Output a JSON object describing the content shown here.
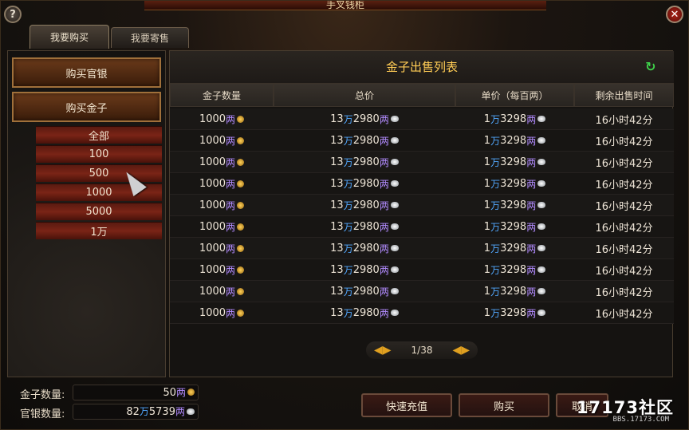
{
  "window": {
    "title": "手叉钱柜"
  },
  "tabs": [
    {
      "label": "我要购买"
    },
    {
      "label": "我要寄售"
    }
  ],
  "left_nav": {
    "buy_silver": "购买官银",
    "buy_gold": "购买金子",
    "filters": [
      "全部",
      "100",
      "500",
      "1000",
      "5000",
      "1万"
    ]
  },
  "list": {
    "title": "金子出售列表",
    "columns": [
      "金子数量",
      "总价",
      "单价（每百两）",
      "剩余出售时间"
    ],
    "units": {
      "liang": "两",
      "wan": "万"
    },
    "rows": [
      {
        "qty": "1000",
        "total_wan": "13",
        "total_rest": "2980",
        "unit_wan": "1",
        "unit_rest": "3298",
        "time": "16小时42分"
      },
      {
        "qty": "1000",
        "total_wan": "13",
        "total_rest": "2980",
        "unit_wan": "1",
        "unit_rest": "3298",
        "time": "16小时42分"
      },
      {
        "qty": "1000",
        "total_wan": "13",
        "total_rest": "2980",
        "unit_wan": "1",
        "unit_rest": "3298",
        "time": "16小时42分"
      },
      {
        "qty": "1000",
        "total_wan": "13",
        "total_rest": "2980",
        "unit_wan": "1",
        "unit_rest": "3298",
        "time": "16小时42分"
      },
      {
        "qty": "1000",
        "total_wan": "13",
        "total_rest": "2980",
        "unit_wan": "1",
        "unit_rest": "3298",
        "time": "16小时42分"
      },
      {
        "qty": "1000",
        "total_wan": "13",
        "total_rest": "2980",
        "unit_wan": "1",
        "unit_rest": "3298",
        "time": "16小时42分"
      },
      {
        "qty": "1000",
        "total_wan": "13",
        "total_rest": "2980",
        "unit_wan": "1",
        "unit_rest": "3298",
        "time": "16小时42分"
      },
      {
        "qty": "1000",
        "total_wan": "13",
        "total_rest": "2980",
        "unit_wan": "1",
        "unit_rest": "3298",
        "time": "16小时42分"
      },
      {
        "qty": "1000",
        "total_wan": "13",
        "total_rest": "2980",
        "unit_wan": "1",
        "unit_rest": "3298",
        "time": "16小时42分"
      },
      {
        "qty": "1000",
        "total_wan": "13",
        "total_rest": "2980",
        "unit_wan": "1",
        "unit_rest": "3298",
        "time": "16小时42分"
      }
    ],
    "pagination": "1/38"
  },
  "footer": {
    "gold_label": "金子数量:",
    "gold_value": "50",
    "silver_label": "官银数量:",
    "silver_wan": "82",
    "silver_rest": "5739",
    "recharge_btn": "快速充值",
    "buy_btn": "购买",
    "third_btn": "取消"
  },
  "watermark": {
    "brand": "17173社区",
    "url": "BBS.17173.COM"
  },
  "icons": {
    "help": "help-icon",
    "close": "close-icon",
    "refresh": "refresh-icon",
    "gold": "gold-coin-icon",
    "silver": "silver-ingot-icon"
  },
  "colors": {
    "title_gold": "#ffcc55",
    "liang_purple": "#b28bff",
    "wan_blue": "#52a8ff",
    "refresh_green": "#3ed14a"
  }
}
